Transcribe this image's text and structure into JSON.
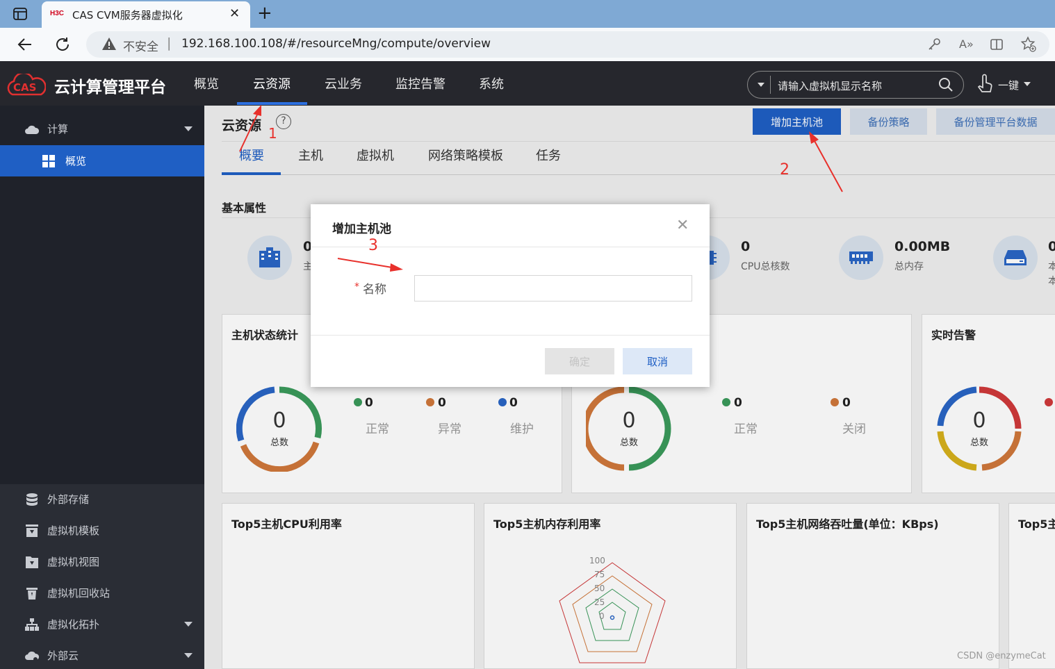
{
  "browser": {
    "tab_title": "CAS CVM服务器虚拟化",
    "tab_brand": "H3C",
    "security_label": "不安全",
    "url": "192.168.100.108/#/resourceMng/compute/overview"
  },
  "app": {
    "logo_text": "CAS",
    "title": "云计算管理平台",
    "nav": [
      "概览",
      "云资源",
      "云业务",
      "监控告警",
      "系统"
    ],
    "active_nav": "云资源",
    "search_placeholder": "请输入虚拟机显示名称",
    "user_label": "一键"
  },
  "sidebar": {
    "compute_label": "计算",
    "overview_label": "概览",
    "items": [
      "外部存储",
      "虚拟机模板",
      "虚拟机视图",
      "虚拟机回收站",
      "虚拟化拓扑",
      "外部云"
    ]
  },
  "page": {
    "title": "云资源",
    "buttons": [
      "增加主机池",
      "备份策略",
      "备份管理平台数据"
    ],
    "tabs": [
      "概要",
      "主机",
      "虚拟机",
      "网络策略模板",
      "任务"
    ],
    "section_title": "基本属性",
    "stats": [
      {
        "value": "0",
        "label": "主"
      },
      {
        "value": "0",
        "label": "CPU总核数"
      },
      {
        "value": "0.00MB",
        "label": "总内存"
      },
      {
        "value": "0",
        "label": "本"
      },
      {
        "value": "",
        "label": "本"
      }
    ]
  },
  "panels": {
    "host_status": {
      "title": "主机状态统计",
      "total": "0",
      "total_label": "总数",
      "items": [
        {
          "label": "正常",
          "value": "0",
          "color": "#3a9a5b"
        },
        {
          "label": "异常",
          "value": "0",
          "color": "#d0783a"
        },
        {
          "label": "维护",
          "value": "0",
          "color": "#2a66c6"
        }
      ]
    },
    "vm_status": {
      "total": "0",
      "total_label": "总数",
      "items": [
        {
          "label": "正常",
          "value": "0",
          "color": "#3a9a5b"
        },
        {
          "label": "关闭",
          "value": "0",
          "color": "#d0783a"
        }
      ]
    },
    "alarms": {
      "title": "实时告警",
      "total": "0",
      "total_label": "总数"
    },
    "top_cpu": {
      "title": "Top5主机CPU利用率"
    },
    "top_mem": {
      "title": "Top5主机内存利用率",
      "radar_ticks": [
        "100",
        "75",
        "50",
        "25",
        "0"
      ]
    },
    "top_net": {
      "title": "Top5主机网络吞吐量(单位：KBps)"
    },
    "top_more": {
      "title": "Top5主"
    }
  },
  "modal": {
    "title": "增加主机池",
    "required_mark": "*",
    "field_label": "名称",
    "field_value": "",
    "confirm_label": "确定",
    "cancel_label": "取消"
  },
  "annotations": [
    "1",
    "2",
    "3"
  ],
  "watermark": "CSDN @enzymeCat",
  "colors": {
    "accent": "#1f5fc4",
    "annotation_red": "#e8302b",
    "header_bg": "#26272d",
    "sidebar_bg": "#1f222a"
  }
}
